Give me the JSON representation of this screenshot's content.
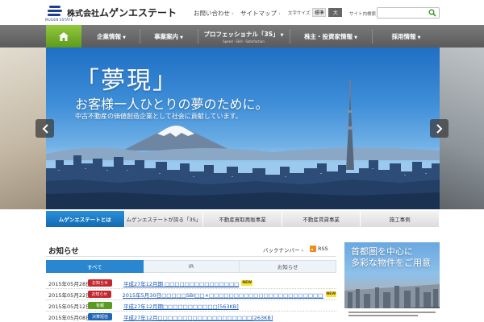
{
  "header": {
    "logo_company": "株式会社",
    "logo_name": "ムゲンエステート",
    "logo_sub": "MUGEN ESTATE",
    "contact_label": "お問い合わせ",
    "sitemap_label": "サイトマップ",
    "font_size_label": "文字サイズ",
    "font_size_standard": "標準",
    "font_size_large": "大",
    "search_label": "サイト内検索",
    "search_placeholder": ""
  },
  "nav": {
    "items": [
      {
        "label": "企業情報"
      },
      {
        "label": "事業案内"
      },
      {
        "label": "プロフェッショナル「3S」",
        "sub": "Speed · Skill · Satisfaction"
      },
      {
        "label": "株主・投資家情報"
      },
      {
        "label": "採用情報"
      }
    ]
  },
  "hero": {
    "title": "「夢現」",
    "subtitle": "お客様一人ひとりの夢のために。",
    "tagline": "中古不動産の価値創造企業として社会に貢献しています。"
  },
  "tabs": [
    {
      "label": "ムゲンエステートとは",
      "active": true
    },
    {
      "label": "ムゲンエステートが誇る「3S」",
      "active": false
    },
    {
      "label": "不動産買取再販事業",
      "active": false
    },
    {
      "label": "不動産賃貸事業",
      "active": false
    },
    {
      "label": "施工事例",
      "active": false
    }
  ],
  "news": {
    "title": "お知らせ",
    "back_numbers": "バックナンバー",
    "rss": "RSS",
    "tabs": [
      {
        "label": "すべて",
        "active": true
      },
      {
        "label": "IR",
        "active": false
      },
      {
        "label": "お知らせ",
        "active": false
      }
    ],
    "items": [
      {
        "date": "2015年05月28日",
        "category": "お知らせ",
        "title": "平成27年12月期 □□□□□□□□□□□□□□□",
        "new": true
      },
      {
        "date": "2015年05月22日",
        "category": "お知らせ",
        "title": "2015年5月30日□□□□□SBI□□×□□□□□□□□□□□□□□□□□□□□□□□□□",
        "new": true
      },
      {
        "date": "2015年05月12日",
        "category": "有報",
        "title": "平成27年12月期□□□□□□□□□□□[563KB]",
        "new": false
      },
      {
        "date": "2015年05月08日",
        "category": "決算短信",
        "title": "平成27年12月□□□□□□□□□□□□□□□□□□□[263KB]",
        "new": false
      }
    ],
    "new_label": "NEW",
    "category_colors": {
      "お知らせ": "#c4262d",
      "有報": "#5a9b1f",
      "決算短信": "#1f64b5"
    }
  },
  "banner": {
    "line1": "首都圏を中心に",
    "line2": "多彩な物件をご用意"
  },
  "colors": {
    "nav_bg": "#666666",
    "home_green": "#6aa92a",
    "accent_blue": "#2a86cf"
  }
}
